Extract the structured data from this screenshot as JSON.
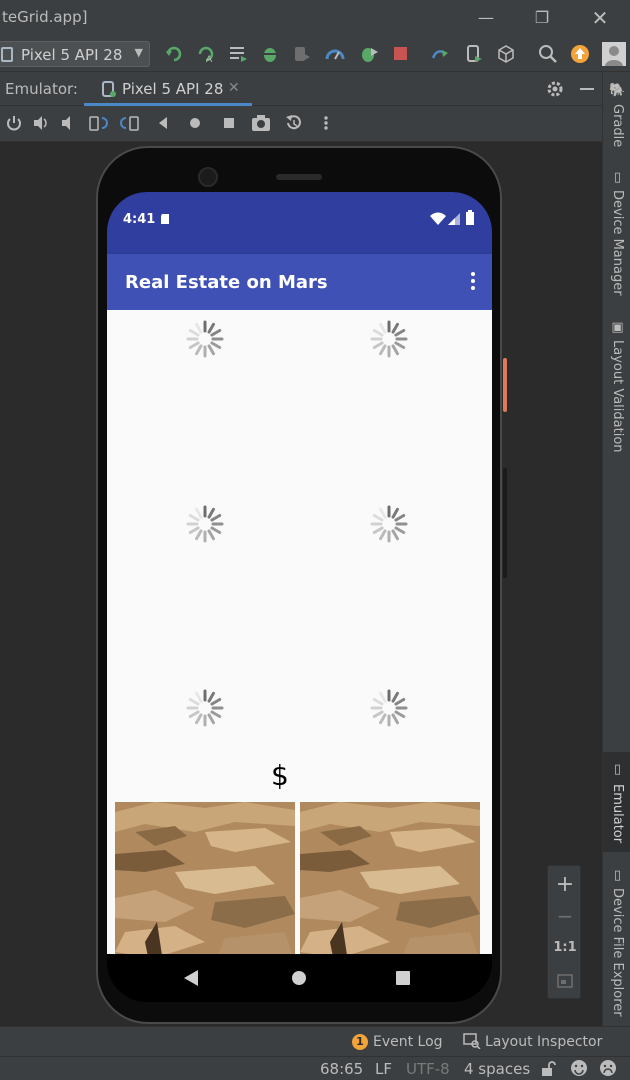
{
  "window": {
    "title": "teGrid.app]"
  },
  "toolbar": {
    "device_selector": "Pixel 5 API 28"
  },
  "emulator_panel": {
    "label": "Emulator:",
    "tab": "Pixel 5 API 28"
  },
  "right_stripe": {
    "tabs": [
      "Gradle",
      "Device Manager",
      "Layout Validation",
      "Emulator",
      "Device File Explorer"
    ],
    "active": "Emulator"
  },
  "device": {
    "status_time": "4:41",
    "app_title": "Real Estate on Mars",
    "price_symbol": "$",
    "loading_cells": 6
  },
  "zoom": {
    "plus": "+",
    "minus": "−",
    "ratio": "1:1"
  },
  "bottom_tools": {
    "event_log": "Event Log",
    "event_log_count": "1",
    "layout_inspector": "Layout Inspector"
  },
  "status_bar": {
    "position": "68:65",
    "line_sep": "LF",
    "encoding": "UTF-8",
    "indent": "4 spaces"
  },
  "colors": {
    "primary": "#3f51b5",
    "primary_dark": "#303f9f",
    "ide_bg": "#2b2b2b",
    "ide_panel": "#3c3f41",
    "accent_tab": "#4a88c7"
  }
}
